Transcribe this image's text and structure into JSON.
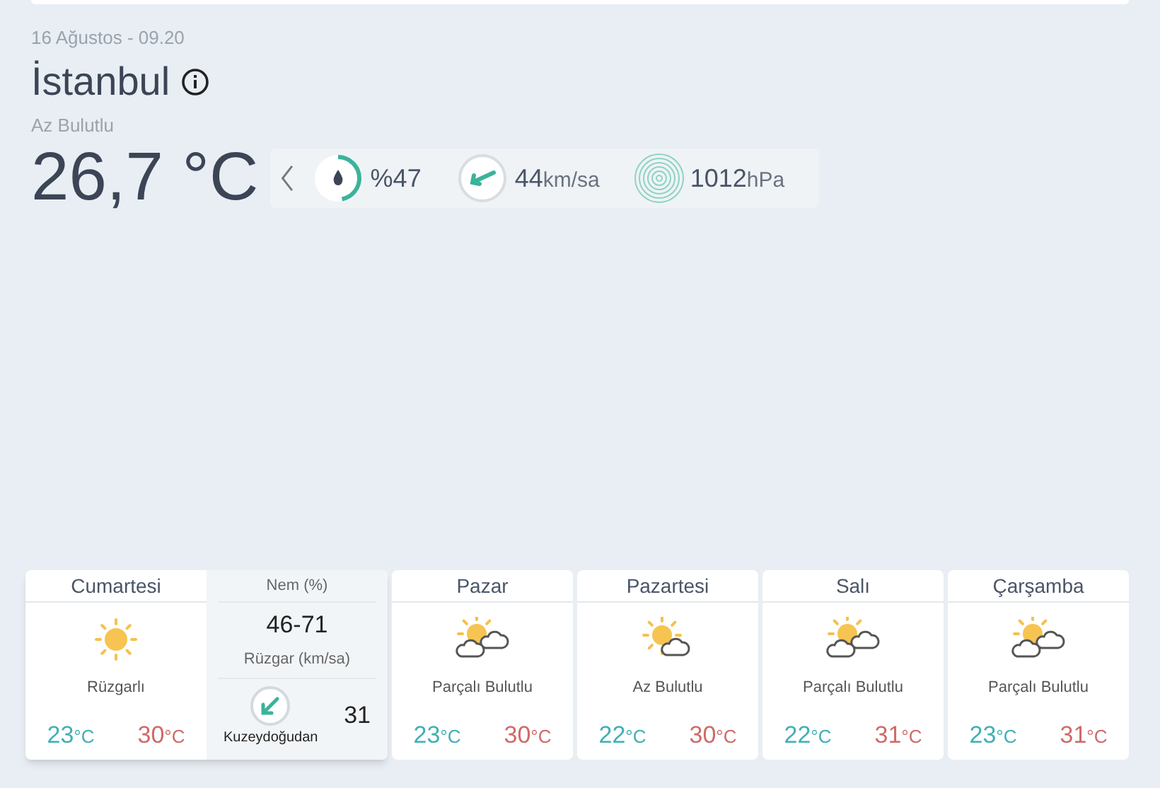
{
  "current": {
    "date": "16 Ağustos - 09.20",
    "city": "İstanbul",
    "condition": "Az Bulutlu",
    "temperature": "26,7 °C",
    "metrics": [
      {
        "kind": "humidity",
        "value": "%47"
      },
      {
        "kind": "wind",
        "value": "44",
        "unit": "km/sa"
      },
      {
        "kind": "pressure",
        "value": "1012",
        "unit": "hPa"
      }
    ]
  },
  "forecast": [
    {
      "day": "Cumartesi",
      "kind": "sunny",
      "condition": "Rüzgarlı",
      "low": {
        "value": "23",
        "unit": "°C"
      },
      "high": {
        "value": "30",
        "unit": "°C"
      },
      "selected": true,
      "details": {
        "humidity_label": "Nem (%)",
        "humidity": "46-71",
        "wind_label": "Rüzgar (km/sa)",
        "wind_direction": "Kuzeydoğudan",
        "wind_speed": "31"
      }
    },
    {
      "day": "Pazar",
      "kind": "partly_cloudy",
      "condition": "Parçalı Bulutlu",
      "low": {
        "value": "23",
        "unit": "°C"
      },
      "high": {
        "value": "30",
        "unit": "°C"
      },
      "selected": false
    },
    {
      "day": "Pazartesi",
      "kind": "mostly_sunny",
      "condition": "Az Bulutlu",
      "low": {
        "value": "22",
        "unit": "°C"
      },
      "high": {
        "value": "30",
        "unit": "°C"
      },
      "selected": false
    },
    {
      "day": "Salı",
      "kind": "partly_cloudy",
      "condition": "Parçalı Bulutlu",
      "low": {
        "value": "22",
        "unit": "°C"
      },
      "high": {
        "value": "31",
        "unit": "°C"
      },
      "selected": false
    },
    {
      "day": "Çarşamba",
      "kind": "partly_cloudy",
      "condition": "Parçalı Bulutlu",
      "low": {
        "value": "23",
        "unit": "°C"
      },
      "high": {
        "value": "31",
        "unit": "°C"
      },
      "selected": false
    }
  ]
}
